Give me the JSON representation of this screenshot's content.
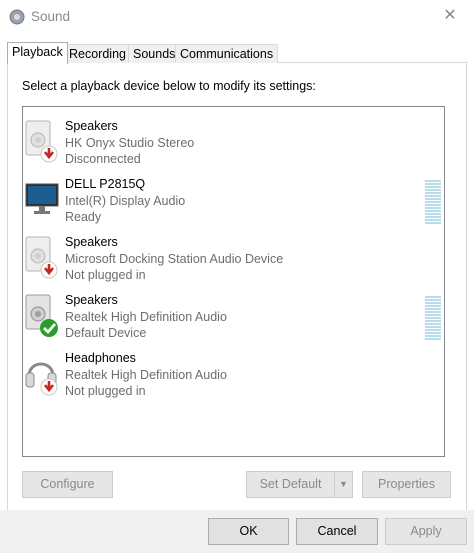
{
  "window": {
    "title": "Sound",
    "close_glyph": "✕"
  },
  "tabs": [
    {
      "label": "Playback",
      "active": true
    },
    {
      "label": "Recording",
      "active": false
    },
    {
      "label": "Sounds",
      "active": false
    },
    {
      "label": "Communications",
      "active": false
    }
  ],
  "prompt": "Select a playback device below to modify its settings:",
  "devices": [
    {
      "name": "Speakers",
      "driver": "HK Onyx Studio Stereo",
      "status": "Disconnected",
      "icon": "speaker-icon",
      "badge": "unplugged-arrow-icon"
    },
    {
      "name": "DELL P2815Q",
      "driver": "Intel(R) Display Audio",
      "status": "Ready",
      "icon": "monitor-icon",
      "badge": ""
    },
    {
      "name": "Speakers",
      "driver": "Microsoft Docking Station Audio Device",
      "status": "Not plugged in",
      "icon": "speaker-icon",
      "badge": "unplugged-arrow-icon"
    },
    {
      "name": "Speakers",
      "driver": "Realtek High Definition Audio",
      "status": "Default Device",
      "icon": "speaker-icon",
      "badge": "default-check-icon"
    },
    {
      "name": "Headphones",
      "driver": "Realtek High Definition Audio",
      "status": "Not plugged in",
      "icon": "headphones-icon",
      "badge": "unplugged-arrow-icon"
    }
  ],
  "buttons": {
    "configure": "Configure",
    "set_default": "Set Default",
    "properties": "Properties",
    "ok": "OK",
    "cancel": "Cancel",
    "apply": "Apply"
  },
  "colors": {
    "accent_check": "#2a9d2a",
    "unplugged_red": "#c62828",
    "meter": "#b9dcea"
  }
}
